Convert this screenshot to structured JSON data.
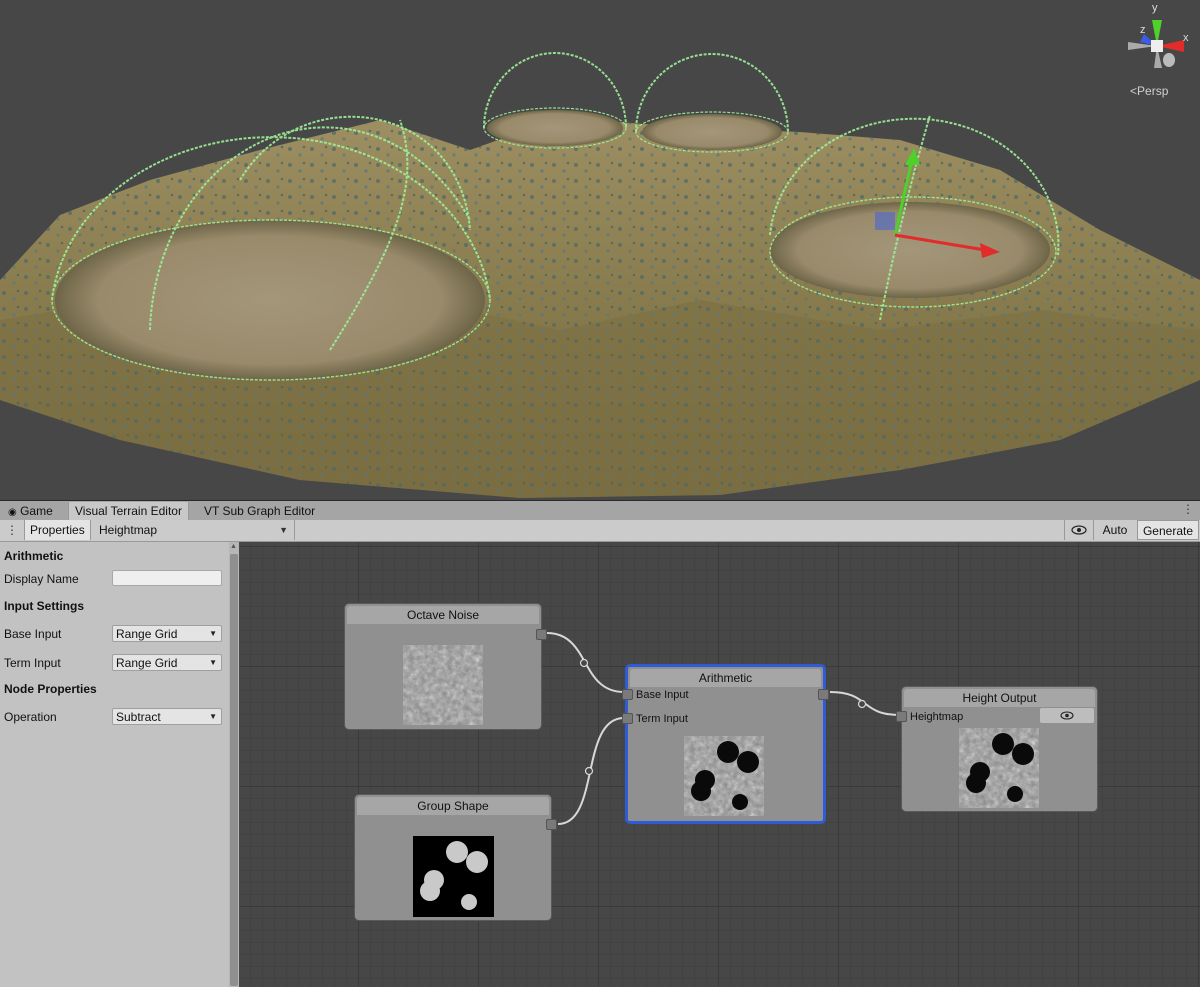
{
  "scene": {
    "gizmo": {
      "axis_x": "x",
      "axis_y": "y",
      "axis_z": "z",
      "icon": "scene-orientation-gizmo"
    },
    "perspective_label": "Persp"
  },
  "tabs": [
    {
      "label": "Game",
      "icon": "gamepad-icon"
    },
    {
      "label": "Visual Terrain Editor"
    },
    {
      "label": "VT Sub Graph Editor"
    }
  ],
  "toolbar": {
    "properties_label": "Properties",
    "graph_selected": "Heightmap",
    "preview_icon": "eye-icon",
    "auto_label": "Auto",
    "generate_label": "Generate"
  },
  "properties": {
    "node_type": "Arithmetic",
    "display_name_label": "Display Name",
    "display_name_value": "",
    "input_settings_header": "Input Settings",
    "base_input_label": "Base Input",
    "base_input_value": "Range Grid",
    "term_input_label": "Term Input",
    "term_input_value": "Range Grid",
    "node_properties_header": "Node Properties",
    "operation_label": "Operation",
    "operation_value": "Subtract"
  },
  "nodes": {
    "octave_noise": {
      "title": "Octave Noise"
    },
    "group_shape": {
      "title": "Group Shape"
    },
    "arithmetic": {
      "title": "Arithmetic",
      "base_input": "Base Input",
      "term_input": "Term Input"
    },
    "height_output": {
      "title": "Height Output",
      "port": "Heightmap",
      "preview_icon": "eye-icon"
    }
  },
  "colors": {
    "selection_outline": "#2e5bd6",
    "gizmo_x": "#e22b2b",
    "gizmo_y": "#4fd12c",
    "gizmo_z": "#3a5de6",
    "dome_wire": "#9ff09a"
  }
}
